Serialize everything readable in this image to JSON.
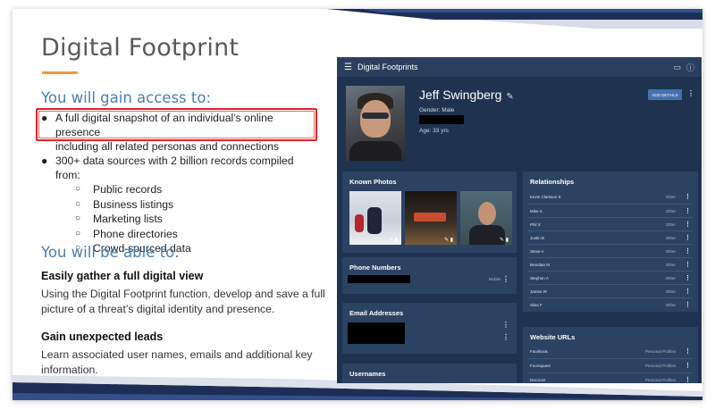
{
  "slide": {
    "title": "Digital Footprint",
    "gain_heading": "You will gain access to:",
    "bullets": [
      "A full digital snapshot of an individual’s online presence",
      "including all related personas and connections",
      "300+ data sources with 2 billion records compiled from:"
    ],
    "sub_bullets": [
      "Public records",
      "Business listings",
      "Marketing lists",
      "Phone directories",
      "Crowd-sourced data"
    ],
    "able_heading": "You will be able to:",
    "point1_heading": "Easily gather a full digital view",
    "point1_text_1": "Using the Digital Footprint function, develop and save a full",
    "point1_text_2": "picture of a threat’s digital identity and presence.",
    "point2_heading": "Gain unexpected leads",
    "point2_text_1": "Learn associated user names, emails and additional key",
    "point2_text_2": "information.",
    "colors": {
      "accent_orange": "#f39a3b",
      "heading_blue": "#4a7fb0",
      "highlight_red": "#e0242b",
      "app_bg": "#1f3350",
      "panel_bg": "#2c4262"
    }
  },
  "app": {
    "title": "Digital Footprints",
    "icons": [
      "menu-icon",
      "chat-icon",
      "help-icon"
    ],
    "profile": {
      "name": "Jeff Swingberg",
      "gender": "Gender: Male",
      "age": "Age: 33 yrs",
      "add_button": "ADD DETAILS"
    },
    "known_photos": {
      "title": "Known Photos"
    },
    "phone_numbers": {
      "title": "Phone Numbers",
      "type": "Mobile"
    },
    "email_addresses": {
      "title": "Email Addresses"
    },
    "usernames": {
      "title": "Usernames"
    },
    "relationships": {
      "title": "Relationships",
      "rows": [
        {
          "name": "Kevin Clarkson S",
          "type": "Other"
        },
        {
          "name": "Mike S",
          "type": "Other"
        },
        {
          "name": "Phil S",
          "type": "Other"
        },
        {
          "name": "Justin B",
          "type": "Other"
        },
        {
          "name": "Steve A",
          "type": "Other"
        },
        {
          "name": "Brendan M",
          "type": "Other"
        },
        {
          "name": "Stephen A",
          "type": "Other"
        },
        {
          "name": "James W",
          "type": "Other"
        },
        {
          "name": "Silas F",
          "type": "Other"
        }
      ]
    },
    "website_urls": {
      "title": "Website URLs",
      "rows": [
        {
          "name": "Facebook",
          "type": "Personal Profiles"
        },
        {
          "name": "Foursquare",
          "type": "Personal Profiles"
        },
        {
          "name": "Discover",
          "type": "Personal Profiles"
        }
      ]
    }
  }
}
